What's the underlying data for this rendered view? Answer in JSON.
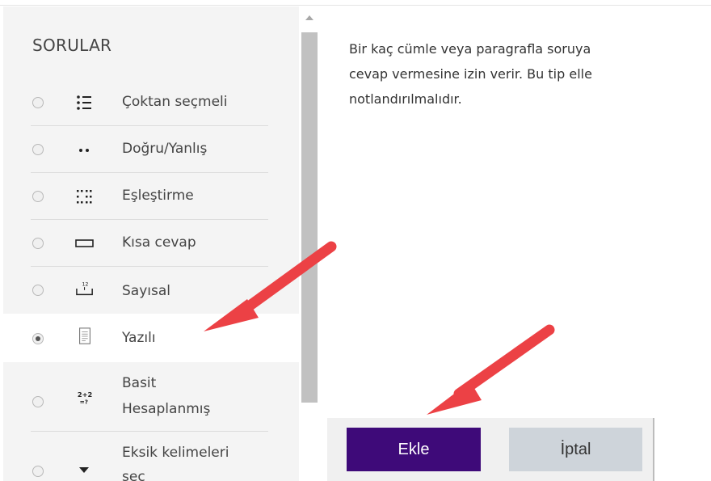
{
  "panel": {
    "title": "SORULAR",
    "items": [
      {
        "label": "Çoktan seçmeli",
        "icon": "multiple-choice-icon",
        "selected": false
      },
      {
        "label": "Doğru/Yanlış",
        "icon": "true-false-icon",
        "selected": false
      },
      {
        "label": "Eşleştirme",
        "icon": "matching-icon",
        "selected": false
      },
      {
        "label": "Kısa cevap",
        "icon": "short-answer-icon",
        "selected": false
      },
      {
        "label": "Sayısal",
        "icon": "numerical-icon",
        "selected": false
      },
      {
        "label": "Yazılı",
        "icon": "essay-icon",
        "selected": true
      },
      {
        "label_line1": "Basit",
        "label_line2": "Hesaplanmış",
        "icon": "calculated-simple-icon",
        "icon_text_top": "2+2",
        "icon_text_bottom": "=?",
        "selected": false
      },
      {
        "label_line1": "Eksik kelimeleri",
        "label_line2": "seç",
        "icon": "select-missing-words-icon",
        "selected": false
      }
    ],
    "numerical_icon_text": "12"
  },
  "description": {
    "line1": "Bir kaç cümle veya paragrafla soruya",
    "line2": "cevap vermesine izin verir. Bu tip elle",
    "line3": "notlandırılmalıdır."
  },
  "footer": {
    "add_label": "Ekle",
    "cancel_label": "İptal"
  },
  "colors": {
    "add_button": "#3e0a79",
    "cancel_button": "#ced4da",
    "arrow": "#ec4145",
    "panel_bg": "#f4f4f4"
  }
}
